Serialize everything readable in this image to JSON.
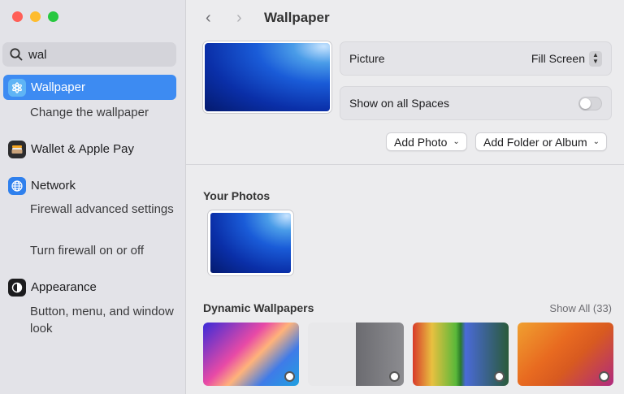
{
  "sidebar": {
    "search": {
      "value": "wal",
      "placeholder": "Search"
    },
    "items": [
      {
        "label": "Wallpaper",
        "icon": "wallpaper-icon",
        "selected": true
      },
      {
        "label": "Change the wallpaper"
      },
      {
        "label": "Wallet & Apple Pay",
        "icon": "wallet-icon"
      },
      {
        "label": "Network",
        "icon": "network-globe-icon"
      },
      {
        "label": "Firewall advanced settings"
      },
      {
        "label": "Turn firewall on or off"
      },
      {
        "label": "Appearance",
        "icon": "appearance-icon"
      },
      {
        "label": "Button, menu, and window look"
      }
    ]
  },
  "header": {
    "title": "Wallpaper",
    "back": "‹",
    "forward": "›"
  },
  "settings": {
    "picture_label": "Picture",
    "picture_value": "Fill Screen",
    "spaces_label": "Show on all Spaces",
    "spaces_on": false,
    "add_photo": "Add Photo",
    "add_folder": "Add Folder or Album"
  },
  "your_photos": {
    "title": "Your Photos"
  },
  "dynamic": {
    "title": "Dynamic Wallpapers",
    "show_all": "Show All (33)"
  },
  "colors": {
    "accent": "#3d8bf2"
  }
}
